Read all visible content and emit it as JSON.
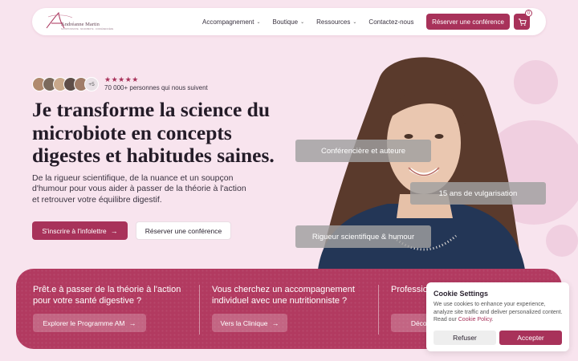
{
  "nav": {
    "logo_name": "Andréanne Martin",
    "logo_tag": "NUTRITIONNISTE · MICROBIOTE · CONFÉRENCIÈRE",
    "menu": [
      {
        "label": "Accompagnement",
        "has_dropdown": true
      },
      {
        "label": "Boutique",
        "has_dropdown": true
      },
      {
        "label": "Ressources",
        "has_dropdown": true
      },
      {
        "label": "Contactez-nous",
        "has_dropdown": false
      }
    ],
    "cta_label": "Réserver une conférence",
    "cart_count": "0"
  },
  "hero": {
    "avatar_more": "+5",
    "stars": "★★★★★",
    "followers": "70 000+ personnes qui nous suivent",
    "headline": "Je transforme la science du microbiote en concepts digestes et habitudes saines.",
    "subtext": "De la rigueur scientifique, de la nuance et un soupçon d'humour pour vous aider à passer de la théorie à l'action et retrouver votre équilibre digestif.",
    "primary_button": "S'inscrire à l'infolettre",
    "secondary_button": "Réserver une conférence"
  },
  "tags": [
    "Conférencière et auteure",
    "15 ans de vulgarisation",
    "Rigueur scientifique & humour"
  ],
  "cards": [
    {
      "question": "Prêt.e à passer de la théorie à l'action pour votre santé digestive ?",
      "button": "Explorer le Programme AM"
    },
    {
      "question": "Vous cherchez un accompagnement individuel avec une nutritionniste ?",
      "button": "Vers la Clinique"
    },
    {
      "question": "Professionnel.le en quête d'outils ?",
      "button": "Découvrir"
    }
  ],
  "cookie": {
    "title": "Cookie Settings",
    "text": "We use cookies to enhance your experience, analyze site traffic and deliver personalized content. Read our ",
    "link": "Cookie Policy",
    "text_end": ".",
    "refuse": "Refuser",
    "accept": "Accepter"
  },
  "colors": {
    "accent": "#a8325a",
    "band": "#b23a60",
    "background": "#f8e4ee"
  }
}
